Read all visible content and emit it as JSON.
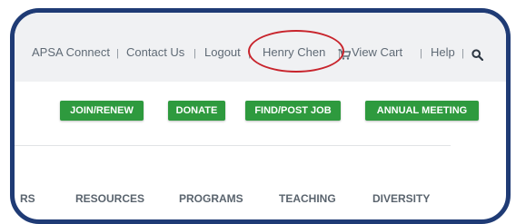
{
  "utility_nav": {
    "links": [
      "APSA Connect",
      "Contact Us",
      "Logout",
      "Henry Chen",
      "View Cart",
      "Help"
    ],
    "separator": "|"
  },
  "cta_buttons": [
    "JOIN/RENEW",
    "DONATE",
    "FIND/POST JOB",
    "ANNUAL MEETING"
  ],
  "main_nav": [
    "RS",
    "RESOURCES",
    "PROGRAMS",
    "TEACHING",
    "DIVERSITY"
  ],
  "icons": {
    "cart": "cart-icon",
    "search": "search-icon"
  },
  "colors": {
    "frame": "#1f3b75",
    "cta": "#2e9a3e",
    "highlight": "#c8242c"
  }
}
